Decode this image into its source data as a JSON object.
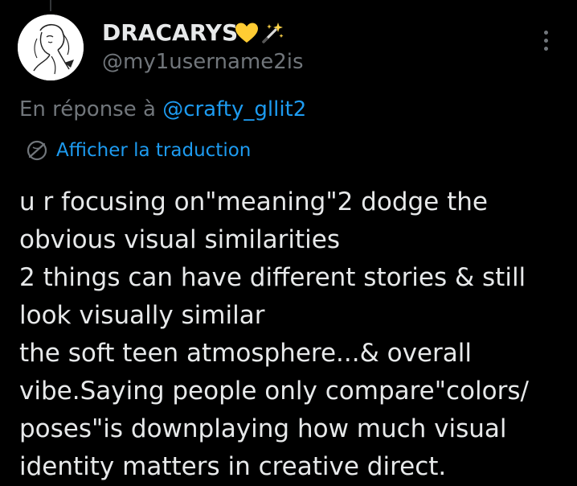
{
  "author": {
    "display_name": "DRACARYS",
    "badge_emojis": [
      "💛",
      "🪄"
    ],
    "username": "@my1username2is"
  },
  "reply": {
    "prefix": "En réponse à",
    "handle": "@crafty_gllit2"
  },
  "translate": {
    "label": "Afficher la traduction",
    "icon": "translate-globe-icon"
  },
  "tweet": {
    "lines": [
      "u r focusing on\"meaning\"2 dodge the",
      "obvious visual similarities",
      "2 things can have different stories & still",
      "look visually similar",
      "the soft teen atmosphere...& overall",
      "vibe.Saying people only compare\"colors/",
      "poses\"is downplaying how much visual",
      "identity matters in creative direct."
    ]
  },
  "colors": {
    "background": "#000000",
    "primary_text": "#e7e9ea",
    "secondary_text": "#71767b",
    "accent": "#1d9bf0"
  }
}
